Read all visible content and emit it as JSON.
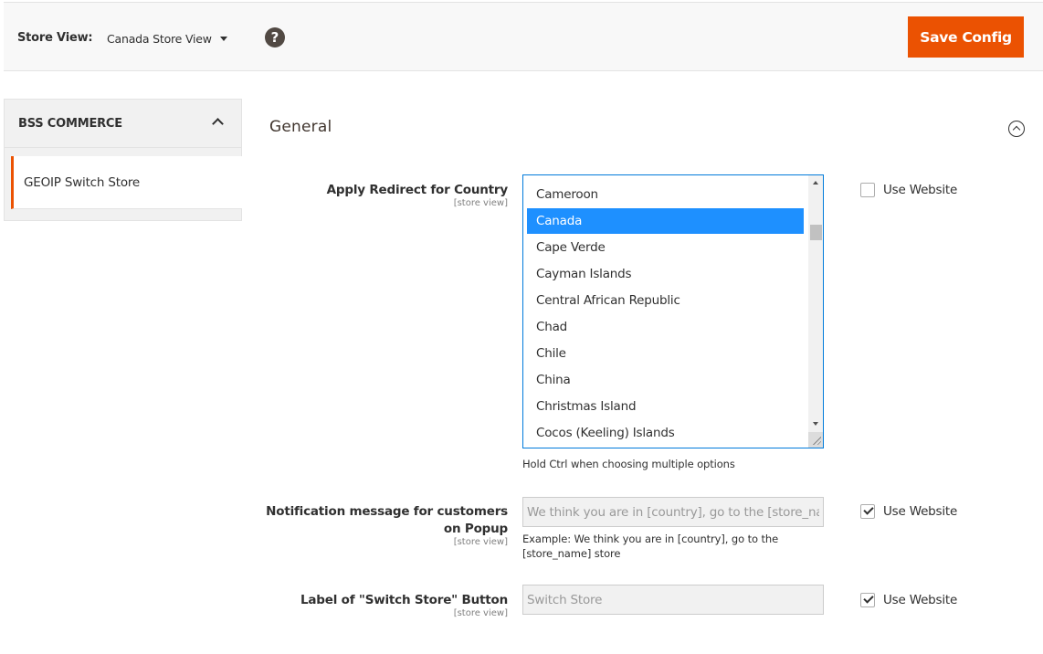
{
  "header": {
    "store_view_label": "Store View:",
    "store_view_value": "Canada Store View",
    "help_icon": "question-mark",
    "save_button": "Save Config"
  },
  "sidebar": {
    "group_title": "BSS COMMERCE",
    "items": [
      {
        "label": "GEOIP Switch Store",
        "active": true
      }
    ]
  },
  "section": {
    "title": "General",
    "fields": [
      {
        "label": "Apply Redirect for Country",
        "scope": "[store view]",
        "type": "multiselect",
        "options": [
          "Cameroon",
          "Canada",
          "Cape Verde",
          "Cayman Islands",
          "Central African Republic",
          "Chad",
          "Chile",
          "China",
          "Christmas Island",
          "Cocos (Keeling) Islands"
        ],
        "selected": [
          "Canada"
        ],
        "note": "Hold Ctrl when choosing multiple options",
        "use_website_label": "Use Website",
        "use_website_checked": false
      },
      {
        "label": "Notification message for customers on Popup",
        "scope": "[store view]",
        "type": "text",
        "value": "We think you are in [country], go to the [store_name] store",
        "note": "Example: We think you are in [country], go to the [store_name] store",
        "use_website_label": "Use Website",
        "use_website_checked": true
      },
      {
        "label": "Label of \"Switch Store\" Button",
        "scope": "[store view]",
        "type": "text",
        "value": "Switch Store",
        "use_website_label": "Use Website",
        "use_website_checked": true
      }
    ]
  },
  "colors": {
    "accent": "#eb5202",
    "selected_option": "#1e90ff",
    "focus_border": "#007bdb"
  }
}
